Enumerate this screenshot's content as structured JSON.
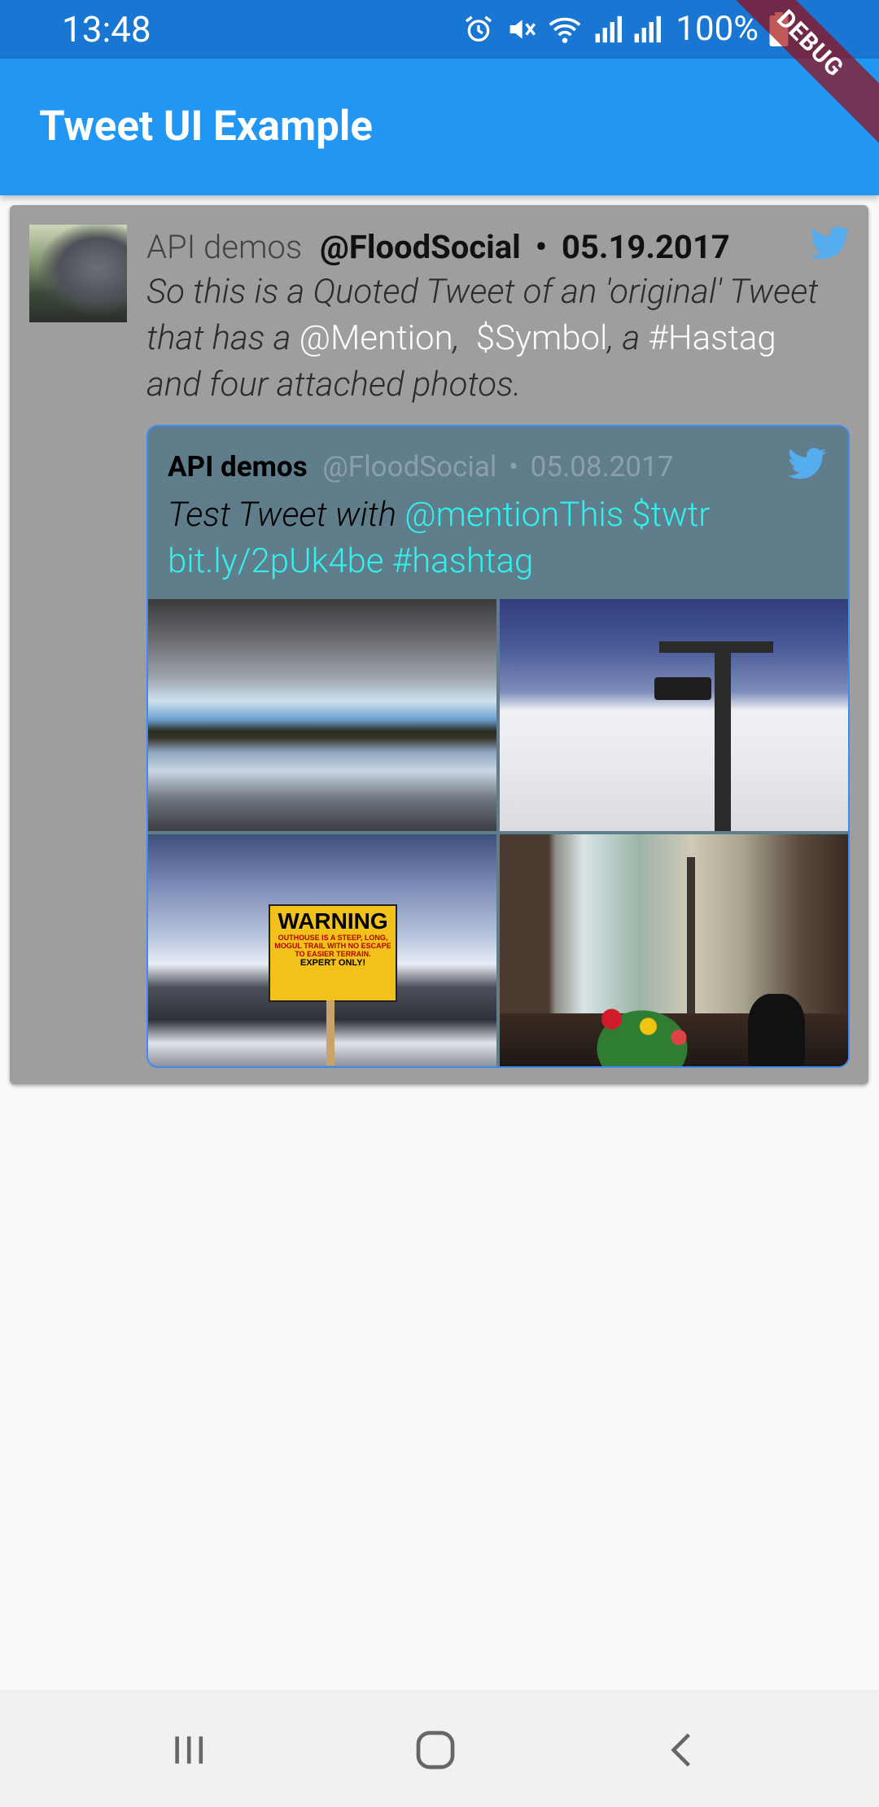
{
  "status_bar": {
    "time": "13:48",
    "battery": "100%",
    "icons": [
      "alarm-icon",
      "mute-icon",
      "wifi-icon",
      "signal-icon",
      "signal-icon",
      "battery-icon"
    ]
  },
  "debug_banner": "DEBUG",
  "app_bar": {
    "title": "Tweet UI Example"
  },
  "tweet": {
    "name": "API demos",
    "handle": "@FloodSocial",
    "separator": "•",
    "date": "05.19.2017",
    "text_parts": {
      "t1": "So this is a Quoted Tweet of an 'original' Tweet that has a ",
      "mention": "@Mention",
      "t2": ",  ",
      "symbol": "$Symbol",
      "t3": ", a ",
      "hashtag": "#Hastag",
      "t4": " and four attached photos."
    },
    "quoted": {
      "name": "API demos",
      "handle": "@FloodSocial",
      "separator": "•",
      "date": "05.08.2017",
      "text_parts": {
        "t1": "Test Tweet with ",
        "mention": "@mentionThis",
        "t2": " ",
        "symbol": "$twtr",
        "t3": " ",
        "url": "bit.ly/2pUk4be",
        "t4": " ",
        "hashtag": "#hashtag"
      },
      "photos": [
        "lake",
        "chairlift",
        "warning-sign",
        "window-cat"
      ],
      "sign": {
        "title": "WARNING",
        "line1": "OUTHOUSE IS A STEEP, LONG, MOGUL TRAIL WITH NO ESCAPE TO EASIER TERRAIN.",
        "line2": "EXPERT ONLY!"
      }
    }
  },
  "colors": {
    "status_bar": "#1976d2",
    "app_bar": "#2196f3",
    "card": "#9e9e9e",
    "quote_bg": "#607d8b",
    "quote_entity": "#2ff3ef",
    "twitter_blue": "#55acee"
  },
  "nav_bar": {
    "buttons": [
      "recents-icon",
      "home-icon",
      "back-icon"
    ]
  }
}
